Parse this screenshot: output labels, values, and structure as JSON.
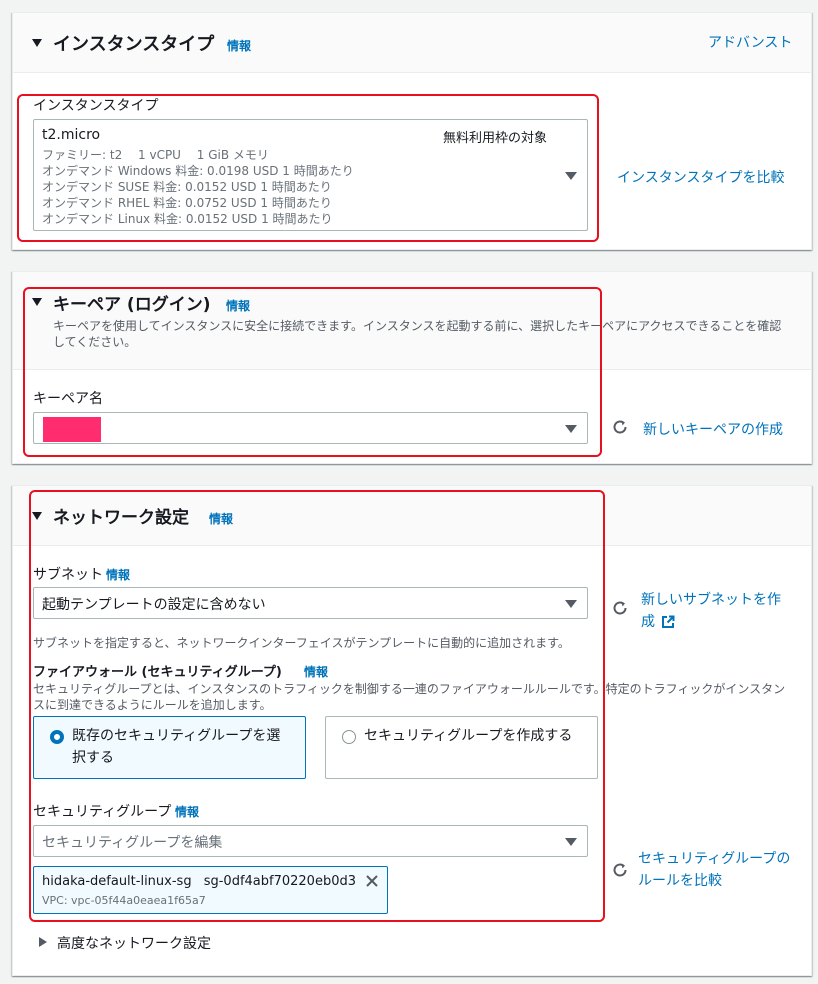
{
  "colors": {
    "link": "#0073bb",
    "redbox": "#e8101e",
    "radio_selected": "#0073bb",
    "tile_selected_bg": "#f1faff"
  },
  "instance_panel": {
    "title": "インスタンスタイプ",
    "info": "情報",
    "advanced": "アドバンスト",
    "field_label": "インスタンスタイプ",
    "selected_type": "t2.micro",
    "free_tier": "無料利用枠の対象",
    "details": [
      "ファミリー: t2　 1 vCPU　 1 GiB メモリ",
      "オンデマンド Windows 料金: 0.0198 USD 1 時間あたり",
      "オンデマンド SUSE 料金: 0.0152 USD 1 時間あたり",
      "オンデマンド RHEL 料金: 0.0752 USD 1 時間あたり",
      "オンデマンド Linux 料金: 0.0152 USD 1 時間あたり"
    ],
    "compare_link": "インスタンスタイプを比較"
  },
  "keypair_panel": {
    "title": "キーペア (ログイン)",
    "info": "情報",
    "description": "キーペアを使用してインスタンスに安全に接続できます。インスタンスを起動する前に、選択したキーペアにアクセスできることを確認してください。",
    "field_label": "キーペア名",
    "create_link": "新しいキーペアの作成"
  },
  "network_panel": {
    "title": "ネットワーク設定",
    "info": "情報",
    "subnet_label": "サブネット",
    "subnet_info": "情報",
    "subnet_value": "起動テンプレートの設定に含めない",
    "subnet_help": "サブネットを指定すると、ネットワークインターフェイスがテンプレートに自動的に追加されます。",
    "new_subnet_link_line1": "新しいサブネットを作",
    "new_subnet_link_line2": "成",
    "firewall_label": "ファイアウォール (セキュリティグループ)",
    "firewall_info": "情報",
    "firewall_desc": "セキュリティグループとは、インスタンスのトラフィックを制御する一連のファイアウォールルールです。特定のトラフィックがインスタンスに到達できるようにルールを追加します。",
    "option_existing_line1": "既存のセキュリティグループを選",
    "option_existing_line2": "択する",
    "option_create": "セキュリティグループを作成する",
    "sg_label": "セキュリティグループ",
    "sg_info": "情報",
    "sg_placeholder": "セキュリティグループを編集",
    "sg_token_name": "hidaka-default-linux-sg",
    "sg_token_id": "sg-0df4abf70220eb0d3",
    "sg_token_vpc": "VPC: vpc-05f44a0eaea1f65a7",
    "compare_rules_line1": "セキュリティグループの",
    "compare_rules_line2": "ルールを比較",
    "advanced_network": "高度なネットワーク設定"
  }
}
